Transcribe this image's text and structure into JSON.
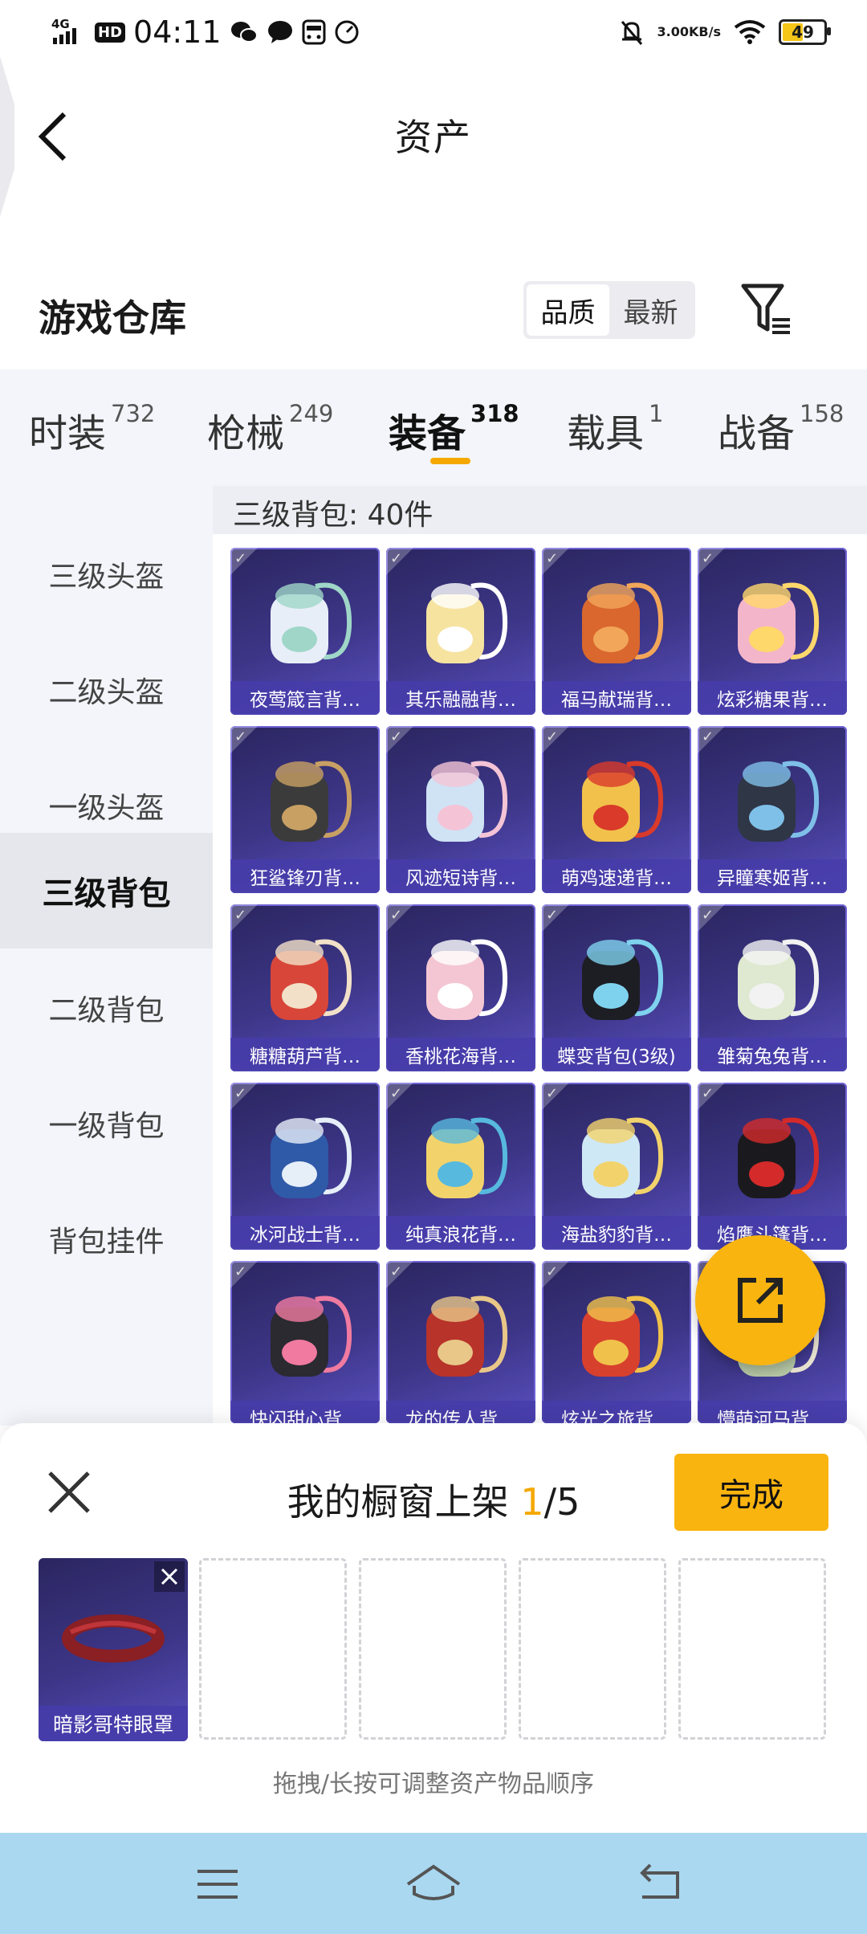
{
  "status_bar": {
    "time": "04:11",
    "signal": "4G",
    "hd": "HD",
    "net_speed_value": "3.00",
    "net_speed_unit": "KB/s",
    "battery": "49",
    "icons": [
      "wechat-icon",
      "message-icon",
      "sim-card-icon",
      "speedometer-icon",
      "mute-bell-icon",
      "wifi-icon"
    ]
  },
  "header": {
    "title": "资产"
  },
  "warehouse": {
    "title": "游戏仓库",
    "sort_options": [
      "品质",
      "最新"
    ],
    "sort_selected": "品质"
  },
  "tabs": [
    {
      "label": "时装",
      "count": "732"
    },
    {
      "label": "枪械",
      "count": "249"
    },
    {
      "label": "装备",
      "count": "318"
    },
    {
      "label": "载具",
      "count": "1"
    },
    {
      "label": "战备",
      "count": "158"
    }
  ],
  "active_tab": "装备",
  "sidebar": [
    {
      "label": "三级头盔"
    },
    {
      "label": "二级头盔"
    },
    {
      "label": "一级头盔"
    },
    {
      "label": "三级背包"
    },
    {
      "label": "二级背包"
    },
    {
      "label": "一级背包"
    },
    {
      "label": "背包挂件"
    }
  ],
  "active_sidebar": "三级背包",
  "grid": {
    "title": "三级背包: 40件",
    "items": [
      {
        "name": "夜莺箴言背…",
        "color": "#e8eef8",
        "accent": "#9fd6c8"
      },
      {
        "name": "其乐融融背…",
        "color": "#f6e3a0",
        "accent": "#ffffff"
      },
      {
        "name": "福马献瑞背…",
        "color": "#d9672e",
        "accent": "#f2a65a"
      },
      {
        "name": "炫彩糖果背…",
        "color": "#f3b5c9",
        "accent": "#ffd86b"
      },
      {
        "name": "狂鲨锋刃背…",
        "color": "#3b3b3b",
        "accent": "#c8a064"
      },
      {
        "name": "风迹短诗背…",
        "color": "#cfe3f5",
        "accent": "#f4c4d6"
      },
      {
        "name": "萌鸡速递背…",
        "color": "#f2c14b",
        "accent": "#d93a2a"
      },
      {
        "name": "异瞳寒姬背…",
        "color": "#2f3646",
        "accent": "#7fc0e8"
      },
      {
        "name": "糖糖葫芦背…",
        "color": "#d8463a",
        "accent": "#f2e1c8"
      },
      {
        "name": "香桃花海背…",
        "color": "#f4c6d3",
        "accent": "#ffffff"
      },
      {
        "name": "蝶变背包(3级)",
        "color": "#1d1d24",
        "accent": "#7fd2ee"
      },
      {
        "name": "雏菊兔兔背…",
        "color": "#dfe8d0",
        "accent": "#f2f2f2"
      },
      {
        "name": "冰河战士背…",
        "color": "#2f5aa8",
        "accent": "#e6eef8"
      },
      {
        "name": "纯真浪花背…",
        "color": "#f2d36b",
        "accent": "#57b9de"
      },
      {
        "name": "海盐豹豹背…",
        "color": "#cfe8f5",
        "accent": "#f2d36b"
      },
      {
        "name": "焰鹰斗篷背…",
        "color": "#1a1a1e",
        "accent": "#d42a2a"
      },
      {
        "name": "快闪甜心背…",
        "color": "#2a2a30",
        "accent": "#f07aa0"
      },
      {
        "name": "龙的传人背…",
        "color": "#b8332a",
        "accent": "#e8c788"
      },
      {
        "name": "炫光之旅背…",
        "color": "#d8402e",
        "accent": "#f0c24b"
      },
      {
        "name": "懵萌河马背…",
        "color": "#b7c9a6",
        "accent": "#e8e2d0"
      }
    ]
  },
  "shelf": {
    "title": "我的橱窗上架",
    "current": "1",
    "separator": "/",
    "total": "5",
    "done_label": "完成",
    "filled_item": {
      "name": "暗影哥特眼罩",
      "color": "#8a1f24"
    },
    "empty_slots": 4,
    "hint": "拖拽/长按可调整资产物品顺序"
  },
  "colors": {
    "accent": "#f9b40f",
    "card_bg": "#3d3688",
    "nav_bg": "#a9d8f0"
  }
}
